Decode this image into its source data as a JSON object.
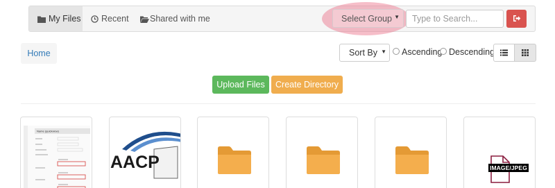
{
  "nav": {
    "tabs": [
      {
        "label": "My Files",
        "icon": "folder-icon"
      },
      {
        "label": "Recent",
        "icon": "clock-icon"
      },
      {
        "label": "Shared with me",
        "icon": "shared-folder-icon"
      }
    ],
    "select_group": {
      "value": "Select Group"
    },
    "search": {
      "placeholder": "Type to Search..."
    },
    "logout_icon": "sign-out-icon"
  },
  "breadcrumb": {
    "home_label": "Home"
  },
  "toolbar": {
    "sort_label": "Sort By",
    "ascending_label": "Ascending",
    "descending_label": "Descending",
    "view_modes": [
      "list-view",
      "grid-view"
    ],
    "active_view": "grid-view"
  },
  "actions": {
    "upload_label": "Upload Files",
    "create_dir_label": "Create Directory"
  },
  "files": [
    {
      "type": "document-thumbnail",
      "thumb_title": "Name (quickview)"
    },
    {
      "type": "image-thumbnail",
      "logo_text": "AACP"
    },
    {
      "type": "folder"
    },
    {
      "type": "folder"
    },
    {
      "type": "folder"
    },
    {
      "type": "image-file",
      "label": "IMAGE/JPEG"
    }
  ],
  "colors": {
    "upload_button": "#5cb85c",
    "create_dir_button": "#f0ad4e",
    "logout_button": "#d9534f",
    "folder": "#f0ad4e",
    "link": "#337ab7",
    "annotation_highlight": "#eb6e87"
  }
}
